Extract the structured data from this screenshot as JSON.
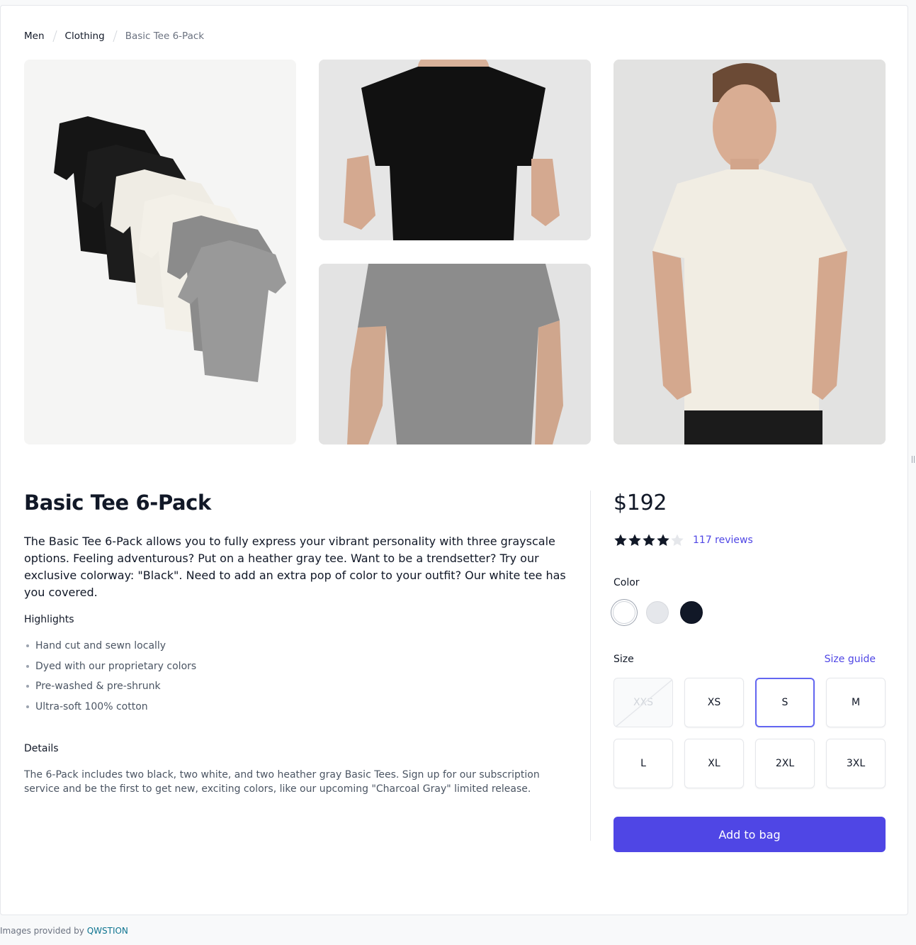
{
  "breadcrumb": {
    "items": [
      "Men",
      "Clothing"
    ],
    "current": "Basic Tee 6-Pack"
  },
  "product": {
    "title": "Basic Tee 6-Pack",
    "description": "The Basic Tee 6-Pack allows you to fully express your vibrant personality with three grayscale options. Feeling adventurous? Put on a heather gray tee. Want to be a trendsetter? Try our exclusive colorway: \"Black\". Need to add an extra pop of color to your outfit? Our white tee has you covered.",
    "price": "$192",
    "rating": 4,
    "rating_max": 5,
    "reviews_label": "117 reviews"
  },
  "highlights": {
    "heading": "Highlights",
    "items": [
      "Hand cut and sewn locally",
      "Dyed with our proprietary colors",
      "Pre-washed & pre-shrunk",
      "Ultra-soft 100% cotton"
    ]
  },
  "details": {
    "heading": "Details",
    "text": "The 6-Pack includes two black, two white, and two heather gray Basic Tees. Sign up for our subscription service and be the first to get new, exciting colors, like our upcoming \"Charcoal Gray\" limited release."
  },
  "color": {
    "label": "Color",
    "options": [
      {
        "name": "White",
        "hex": "#ffffff",
        "selected": true
      },
      {
        "name": "Gray",
        "hex": "#e5e7eb",
        "selected": false
      },
      {
        "name": "Black",
        "hex": "#111827",
        "selected": false
      }
    ]
  },
  "size": {
    "label": "Size",
    "guide_label": "Size guide",
    "options": [
      {
        "label": "XXS",
        "available": false
      },
      {
        "label": "XS",
        "available": true
      },
      {
        "label": "S",
        "available": true,
        "selected": true
      },
      {
        "label": "M",
        "available": true
      },
      {
        "label": "L",
        "available": true
      },
      {
        "label": "XL",
        "available": true
      },
      {
        "label": "2XL",
        "available": true
      },
      {
        "label": "3XL",
        "available": true
      }
    ]
  },
  "cta": {
    "add_to_bag": "Add to bag"
  },
  "footer": {
    "text": "Images provided by ",
    "link": "QWSTION"
  },
  "colors": {
    "accent": "#4f46e5",
    "star_filled": "#111827",
    "star_empty": "#e5e7eb"
  }
}
